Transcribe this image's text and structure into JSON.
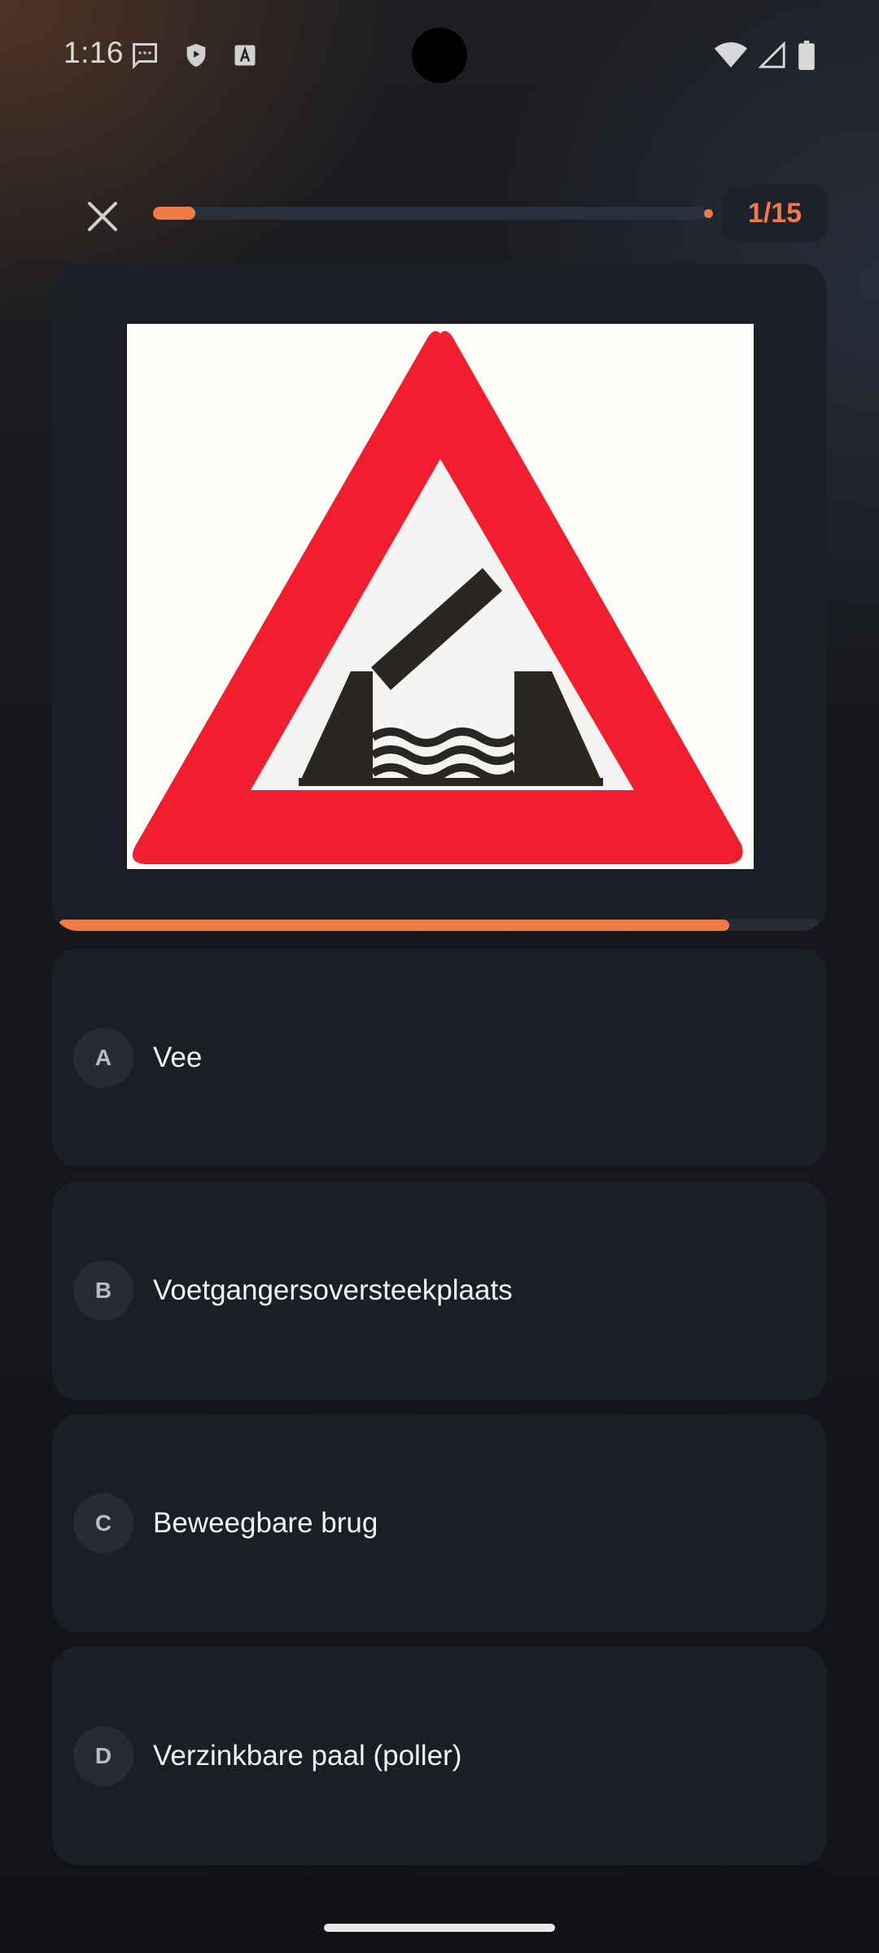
{
  "status_bar": {
    "time": "1:16",
    "icons_left": [
      "message-icon",
      "shield-icon",
      "a-box-icon"
    ],
    "icons_right": [
      "wifi-icon",
      "signal-icon",
      "battery-icon"
    ]
  },
  "header": {
    "counter": "1/15",
    "progress": 0.067,
    "accent_color": "#f07a45"
  },
  "question": {
    "image_alt_icon": "movable-bridge-warning-sign",
    "timer_progress": 0.88
  },
  "options": [
    {
      "letter": "A",
      "text": "Vee"
    },
    {
      "letter": "B",
      "text": "Voetgangersoversteekplaats"
    },
    {
      "letter": "C",
      "text": "Beweegbare brug"
    },
    {
      "letter": "D",
      "text": "Verzinkbare paal (poller)"
    }
  ]
}
